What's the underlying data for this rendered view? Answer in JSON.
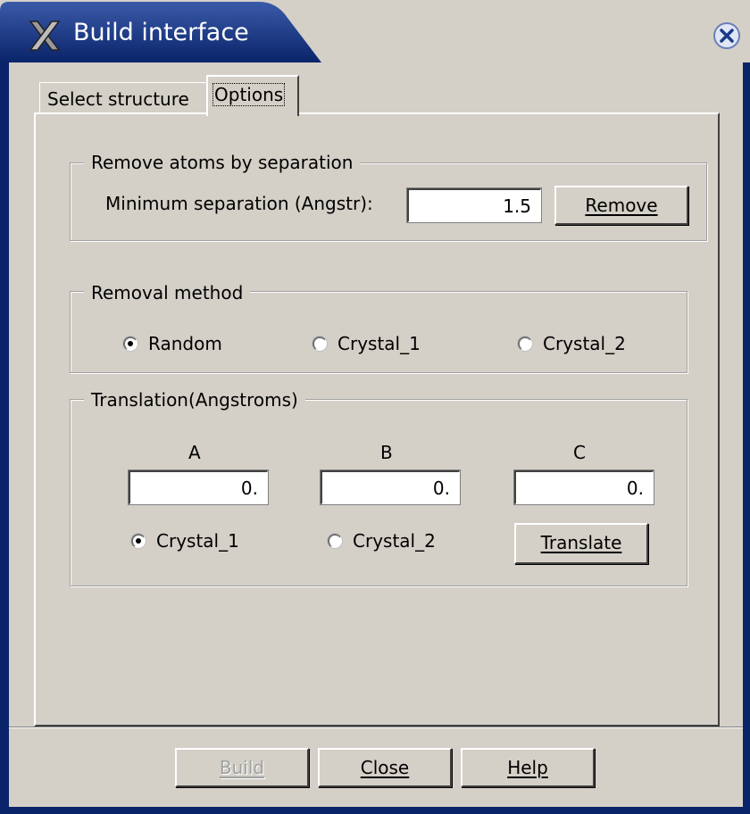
{
  "window": {
    "title": "Build interface",
    "app_icon": "x-logo-icon",
    "close_icon": "close-icon"
  },
  "tabs": [
    {
      "label": "Select structure",
      "active": false
    },
    {
      "label": "Options",
      "active": true
    }
  ],
  "remove_group": {
    "legend": "Remove atoms by separation",
    "min_sep_label": "Minimum separation (Angstr):",
    "min_sep_value": "1.5",
    "remove_button": "Remove"
  },
  "removal_method": {
    "legend": "Removal method",
    "options": [
      {
        "label": "Random",
        "selected": true
      },
      {
        "label": "Crystal_1",
        "selected": false
      },
      {
        "label": "Crystal_2",
        "selected": false
      }
    ]
  },
  "translation": {
    "legend": "Translation(Angstroms)",
    "axes": [
      {
        "label": "A",
        "value": "0."
      },
      {
        "label": "B",
        "value": "0."
      },
      {
        "label": "C",
        "value": "0."
      }
    ],
    "targets": [
      {
        "label": "Crystal_1",
        "selected": true
      },
      {
        "label": "Crystal_2",
        "selected": false
      }
    ],
    "translate_button": "Translate"
  },
  "footer": {
    "build_button": "Build",
    "build_enabled": false,
    "close_button": "Close",
    "help_button": "Help"
  },
  "colors": {
    "title_bar": "#0a246a",
    "face": "#d4d0c8"
  }
}
